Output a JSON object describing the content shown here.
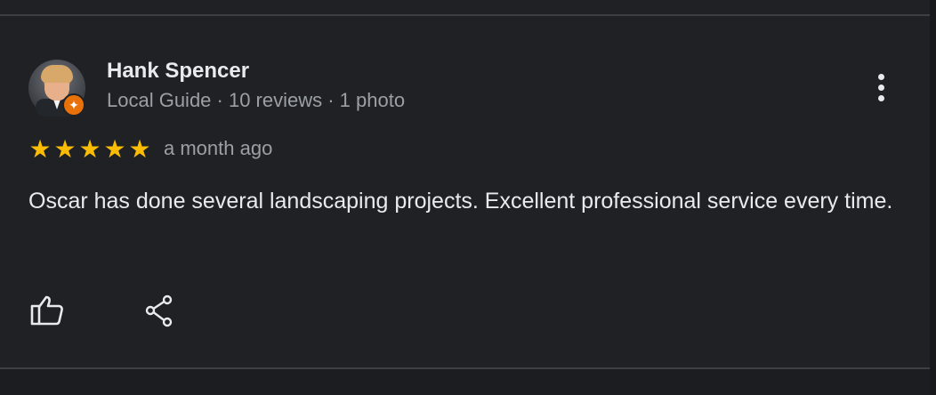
{
  "reviewer": {
    "name": "Hank Spencer",
    "meta": "Local Guide · 10 reviews · 1 photo",
    "badge_icon": "local-guide-star"
  },
  "rating": {
    "stars": 5,
    "star_glyph": "★",
    "date": "a month ago"
  },
  "review": {
    "text": "Oscar has done several landscaping projects. Excellent professional service every time."
  },
  "actions": {
    "like_icon": "thumb-up-icon",
    "share_icon": "share-icon",
    "menu_icon": "more-vert-icon"
  },
  "colors": {
    "background": "#202124",
    "text_primary": "#e8eaed",
    "text_secondary": "#9aa0a6",
    "star": "#fbbc04",
    "badge": "#e8710a"
  }
}
